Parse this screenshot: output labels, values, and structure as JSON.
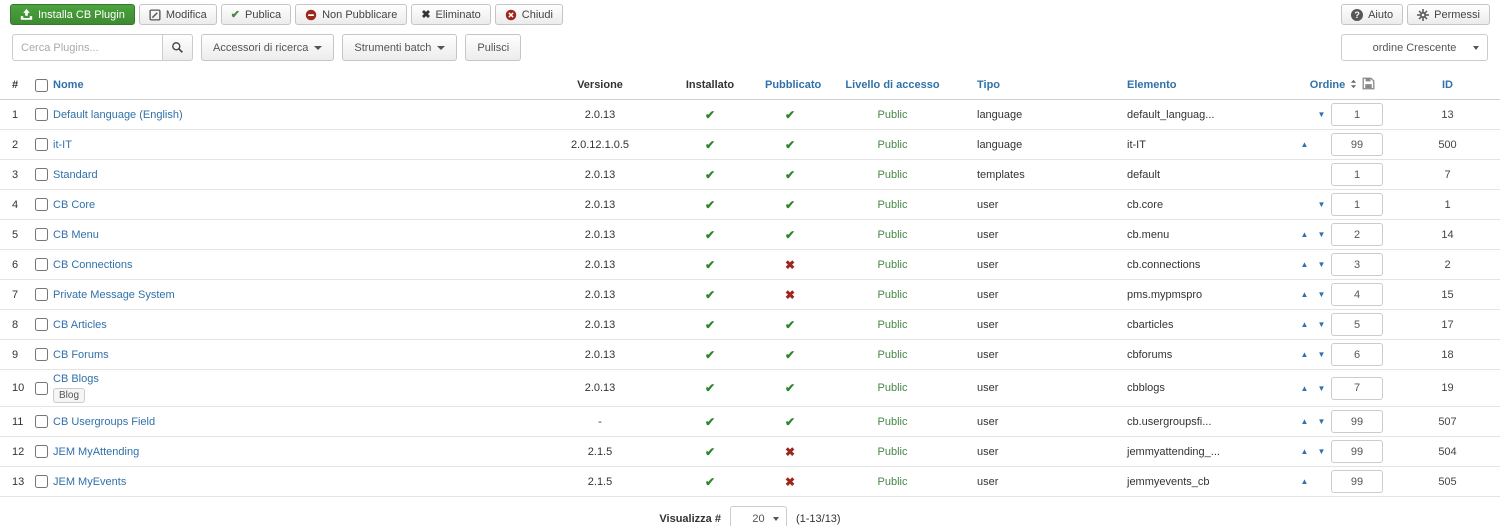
{
  "toolbar": {
    "install": "Installa CB Plugin",
    "modify": "Modifica",
    "publish": "Publica",
    "unpublish": "Non Pubblicare",
    "trash": "Eliminato",
    "close": "Chiudi",
    "help": "Aiuto",
    "permissions": "Permessi"
  },
  "filters": {
    "search_placeholder": "Cerca Plugins...",
    "search_tools": "Accessori di ricerca",
    "batch_tools": "Strumenti batch",
    "clear": "Pulisci",
    "order_select": "ordine Crescente"
  },
  "table": {
    "headers": {
      "num": "#",
      "name": "Nome",
      "version": "Versione",
      "installed": "Installato",
      "published": "Pubblicato",
      "access": "Livello di accesso",
      "type": "Tipo",
      "element": "Elemento",
      "order": "Ordine",
      "id": "ID"
    },
    "rows": [
      {
        "num": "1",
        "name": "Default language (English)",
        "version": "2.0.13",
        "installed": true,
        "published": true,
        "access": "Public",
        "type": "language",
        "element": "default_languag...",
        "up": false,
        "down": true,
        "order": "1",
        "id": "13"
      },
      {
        "num": "2",
        "name": "it-IT",
        "version": "2.0.12.1.0.5",
        "installed": true,
        "published": true,
        "access": "Public",
        "type": "language",
        "element": "it-IT",
        "up": true,
        "down": false,
        "order": "99",
        "id": "500"
      },
      {
        "num": "3",
        "name": "Standard",
        "version": "2.0.13",
        "installed": true,
        "published": true,
        "access": "Public",
        "type": "templates",
        "element": "default",
        "up": false,
        "down": false,
        "order": "1",
        "id": "7"
      },
      {
        "num": "4",
        "name": "CB Core",
        "version": "2.0.13",
        "installed": true,
        "published": true,
        "access": "Public",
        "type": "user",
        "element": "cb.core",
        "up": false,
        "down": true,
        "order": "1",
        "id": "1"
      },
      {
        "num": "5",
        "name": "CB Menu",
        "version": "2.0.13",
        "installed": true,
        "published": true,
        "access": "Public",
        "type": "user",
        "element": "cb.menu",
        "up": true,
        "down": true,
        "order": "2",
        "id": "14"
      },
      {
        "num": "6",
        "name": "CB Connections",
        "version": "2.0.13",
        "installed": true,
        "published": false,
        "access": "Public",
        "type": "user",
        "element": "cb.connections",
        "up": true,
        "down": true,
        "order": "3",
        "id": "2"
      },
      {
        "num": "7",
        "name": "Private Message System",
        "version": "2.0.13",
        "installed": true,
        "published": false,
        "access": "Public",
        "type": "user",
        "element": "pms.mypmspro",
        "up": true,
        "down": true,
        "order": "4",
        "id": "15"
      },
      {
        "num": "8",
        "name": "CB Articles",
        "version": "2.0.13",
        "installed": true,
        "published": true,
        "access": "Public",
        "type": "user",
        "element": "cbarticles",
        "up": true,
        "down": true,
        "order": "5",
        "id": "17"
      },
      {
        "num": "9",
        "name": "CB Forums",
        "version": "2.0.13",
        "installed": true,
        "published": true,
        "access": "Public",
        "type": "user",
        "element": "cbforums",
        "up": true,
        "down": true,
        "order": "6",
        "id": "18"
      },
      {
        "num": "10",
        "name": "CB Blogs",
        "badge": "Blog",
        "version": "2.0.13",
        "installed": true,
        "published": true,
        "access": "Public",
        "type": "user",
        "element": "cbblogs",
        "up": true,
        "down": true,
        "order": "7",
        "id": "19"
      },
      {
        "num": "11",
        "name": "CB Usergroups Field",
        "version": "-",
        "installed": true,
        "published": true,
        "access": "Public",
        "type": "user",
        "element": "cb.usergroupsfi...",
        "up": true,
        "down": true,
        "order": "99",
        "id": "507"
      },
      {
        "num": "12",
        "name": "JEM MyAttending",
        "version": "2.1.5",
        "installed": true,
        "published": false,
        "access": "Public",
        "type": "user",
        "element": "jemmyattending_...",
        "up": true,
        "down": true,
        "order": "99",
        "id": "504"
      },
      {
        "num": "13",
        "name": "JEM MyEvents",
        "version": "2.1.5",
        "installed": true,
        "published": false,
        "access": "Public",
        "type": "user",
        "element": "jemmyevents_cb",
        "up": true,
        "down": false,
        "order": "99",
        "id": "505"
      }
    ]
  },
  "footer": {
    "display_label": "Visualizza #",
    "page_size": "20",
    "range": "(1-13/13)"
  },
  "colors": {
    "link_blue": "#3071a9",
    "button_green": "#3e8a32",
    "check_green": "#2d862d",
    "cross_red": "#9d261d",
    "access_green": "#468847"
  }
}
